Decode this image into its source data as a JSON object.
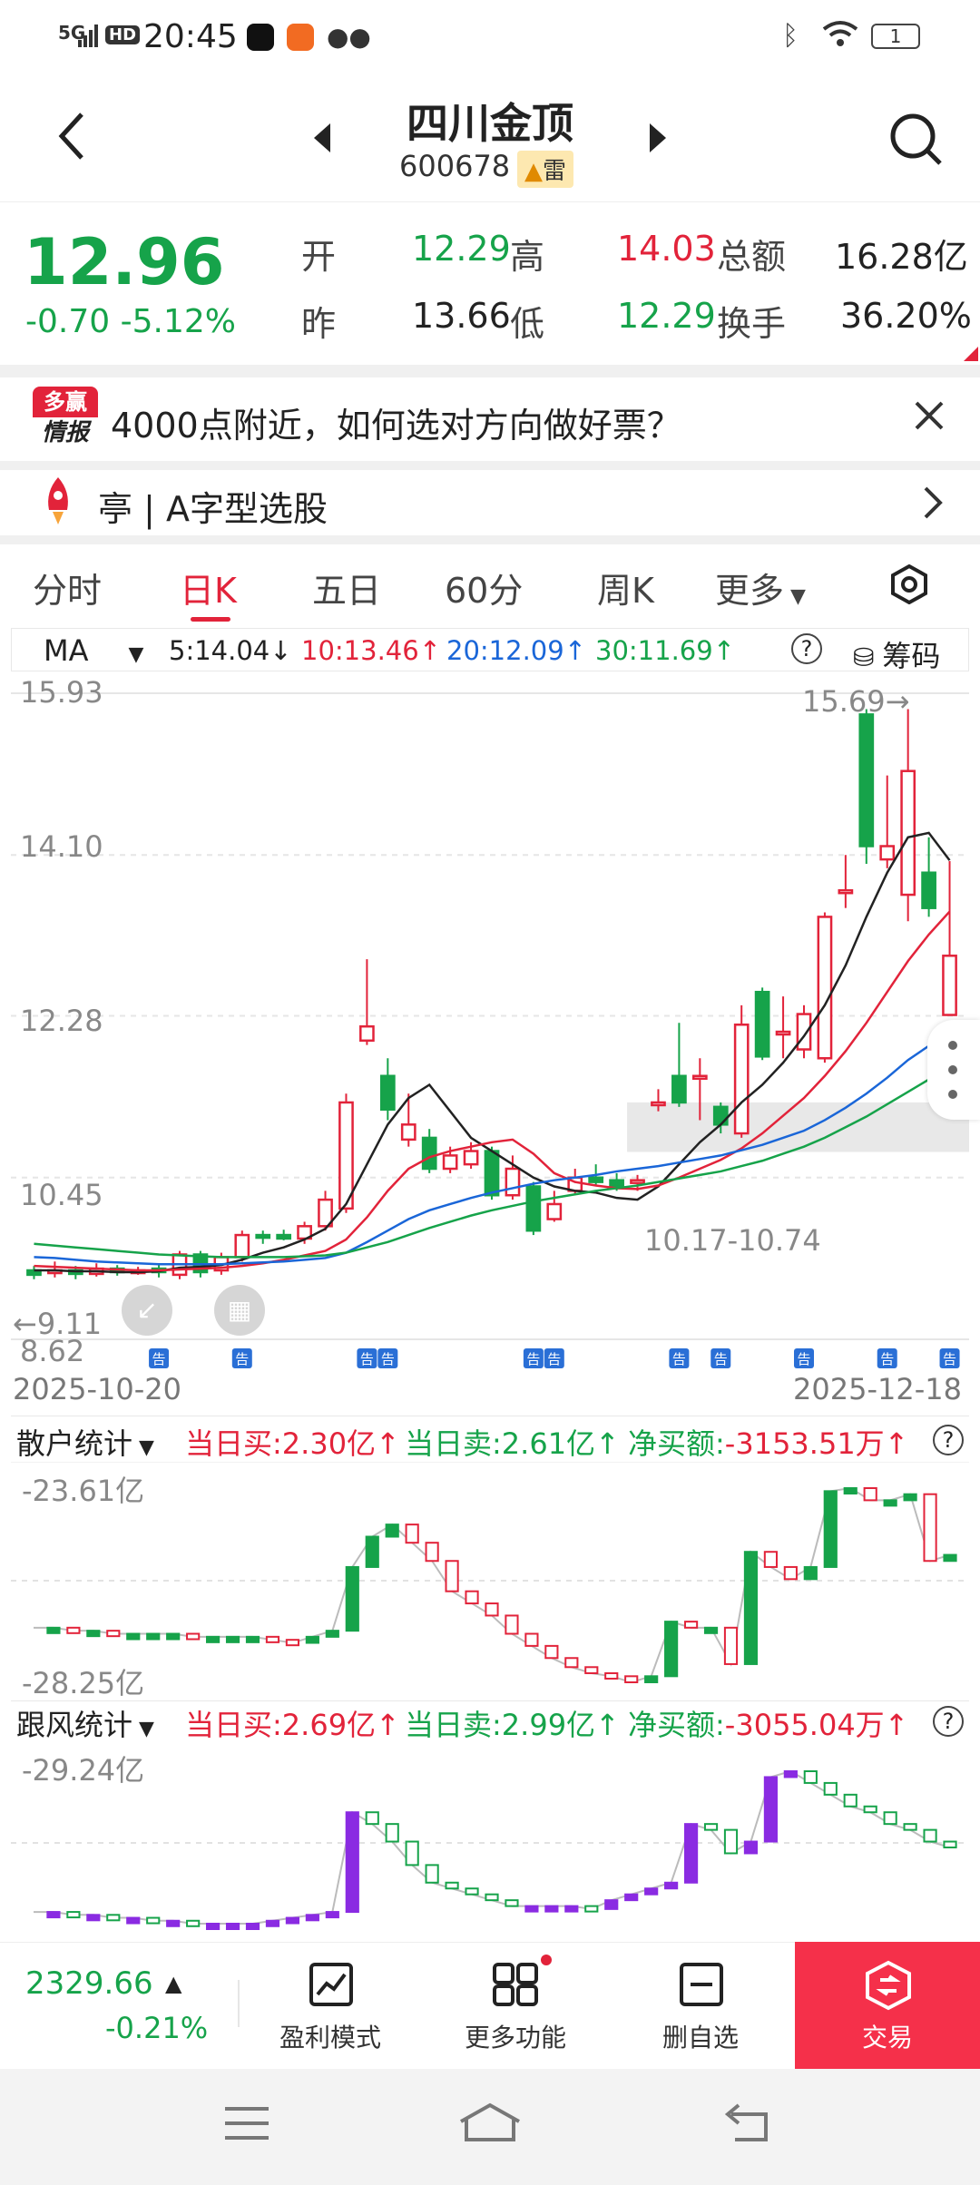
{
  "status": {
    "time": "20:45",
    "network": "5G",
    "battery": "1"
  },
  "header": {
    "title": "四川金顶",
    "code": "600678",
    "badge": "雷"
  },
  "quote": {
    "price": "12.96",
    "change": "-0.70",
    "change_pct": "-5.12%",
    "open_label": "开",
    "open": "12.29",
    "high_label": "高",
    "high": "14.03",
    "amount_label": "总额",
    "amount": "16.28亿",
    "prev_label": "昨",
    "prev": "13.66",
    "low_label": "低",
    "low": "12.29",
    "turnover_label": "换手",
    "turnover": "36.20%"
  },
  "banner": {
    "logo_top": "多赢",
    "logo_bottom": "情报",
    "text": "4000点附近，如何选对方向做好票？"
  },
  "ticker": {
    "text": "亭 | A字型选股"
  },
  "tabs": [
    "分时",
    "日K",
    "五日",
    "60分",
    "周K",
    "更多"
  ],
  "active_tab": "日K",
  "legend": {
    "indicator": "MA",
    "ma5": "5:14.04↓",
    "ma10": "10:13.46↑",
    "ma20": "20:12.09↑",
    "ma30": "30:11.69↑",
    "chips": "筹码"
  },
  "chart_data": {
    "type": "candlestick",
    "y_ticks": [
      "15.93",
      "14.10",
      "12.28",
      "10.45",
      "8.62"
    ],
    "ylim": [
      8.62,
      15.93
    ],
    "x_start": "2025-10-20",
    "x_end": "2025-12-18",
    "max_label": "15.69→",
    "min_label": "←9.11",
    "zone_label": "10.17-10.74",
    "candles": [
      {
        "o": 9.4,
        "c": 9.35,
        "h": 9.45,
        "l": 9.3
      },
      {
        "o": 9.38,
        "c": 9.4,
        "h": 9.5,
        "l": 9.32
      },
      {
        "o": 9.4,
        "c": 9.36,
        "h": 9.45,
        "l": 9.3
      },
      {
        "o": 9.36,
        "c": 9.42,
        "h": 9.48,
        "l": 9.33
      },
      {
        "o": 9.42,
        "c": 9.38,
        "h": 9.46,
        "l": 9.34
      },
      {
        "o": 9.38,
        "c": 9.4,
        "h": 9.44,
        "l": 9.35
      },
      {
        "o": 9.42,
        "c": 9.38,
        "h": 9.46,
        "l": 9.32
      },
      {
        "o": 9.35,
        "c": 9.58,
        "h": 9.62,
        "l": 9.3
      },
      {
        "o": 9.58,
        "c": 9.38,
        "h": 9.62,
        "l": 9.32
      },
      {
        "o": 9.4,
        "c": 9.55,
        "h": 9.6,
        "l": 9.35
      },
      {
        "o": 9.55,
        "c": 9.8,
        "h": 9.85,
        "l": 9.5
      },
      {
        "o": 9.8,
        "c": 9.78,
        "h": 9.85,
        "l": 9.7
      },
      {
        "o": 9.8,
        "c": 9.76,
        "h": 9.86,
        "l": 9.74
      },
      {
        "o": 9.76,
        "c": 9.9,
        "h": 9.95,
        "l": 9.7
      },
      {
        "o": 9.9,
        "c": 10.2,
        "h": 10.3,
        "l": 9.85
      },
      {
        "o": 10.1,
        "c": 11.3,
        "h": 11.4,
        "l": 10.05
      },
      {
        "o": 12.0,
        "c": 12.16,
        "h": 12.92,
        "l": 11.95
      },
      {
        "o": 11.6,
        "c": 11.22,
        "h": 11.8,
        "l": 11.1
      },
      {
        "o": 10.88,
        "c": 11.05,
        "h": 11.4,
        "l": 10.8
      },
      {
        "o": 10.9,
        "c": 10.55,
        "h": 11.0,
        "l": 10.5
      },
      {
        "o": 10.55,
        "c": 10.7,
        "h": 10.8,
        "l": 10.5
      },
      {
        "o": 10.6,
        "c": 10.75,
        "h": 10.85,
        "l": 10.55
      },
      {
        "o": 10.75,
        "c": 10.25,
        "h": 10.8,
        "l": 10.2
      },
      {
        "o": 10.25,
        "c": 10.55,
        "h": 10.7,
        "l": 10.2
      },
      {
        "o": 10.35,
        "c": 9.85,
        "h": 10.4,
        "l": 9.8
      },
      {
        "o": 9.98,
        "c": 10.15,
        "h": 10.3,
        "l": 9.95
      },
      {
        "o": 10.3,
        "c": 10.45,
        "h": 10.55,
        "l": 10.25
      },
      {
        "o": 10.45,
        "c": 10.4,
        "h": 10.6,
        "l": 10.35
      },
      {
        "o": 10.42,
        "c": 10.35,
        "h": 10.5,
        "l": 10.3
      },
      {
        "o": 10.4,
        "c": 10.42,
        "h": 10.48,
        "l": 10.3
      },
      {
        "o": 11.3,
        "c": 11.3,
        "h": 11.45,
        "l": 11.2
      },
      {
        "o": 11.6,
        "c": 11.3,
        "h": 12.2,
        "l": 11.25
      },
      {
        "o": 11.6,
        "c": 11.6,
        "h": 11.8,
        "l": 11.1
      },
      {
        "o": 11.25,
        "c": 11.05,
        "h": 11.3,
        "l": 10.95
      },
      {
        "o": 10.95,
        "c": 12.18,
        "h": 12.4,
        "l": 10.9
      },
      {
        "o": 12.55,
        "c": 11.82,
        "h": 12.6,
        "l": 11.78
      },
      {
        "o": 12.1,
        "c": 12.1,
        "h": 12.5,
        "l": 11.8
      },
      {
        "o": 11.9,
        "c": 12.3,
        "h": 12.4,
        "l": 11.8
      },
      {
        "o": 11.8,
        "c": 13.4,
        "h": 13.45,
        "l": 11.75
      },
      {
        "o": 13.7,
        "c": 13.7,
        "h": 14.1,
        "l": 13.5
      },
      {
        "o": 15.69,
        "c": 14.2,
        "h": 15.75,
        "l": 14.0
      },
      {
        "o": 14.05,
        "c": 14.2,
        "h": 15.0,
        "l": 13.95
      },
      {
        "o": 13.65,
        "c": 15.05,
        "h": 15.75,
        "l": 13.35
      },
      {
        "o": 13.9,
        "c": 13.5,
        "h": 14.3,
        "l": 13.4
      },
      {
        "o": 12.29,
        "c": 12.96,
        "h": 14.03,
        "l": 12.29
      }
    ],
    "ma5": [
      9.4,
      9.4,
      9.39,
      9.39,
      9.38,
      9.38,
      9.39,
      9.43,
      9.44,
      9.46,
      9.52,
      9.6,
      9.66,
      9.75,
      9.87,
      10.15,
      10.6,
      11.05,
      11.35,
      11.5,
      11.2,
      10.9,
      10.75,
      10.6,
      10.45,
      10.35,
      10.3,
      10.28,
      10.22,
      10.2,
      10.35,
      10.6,
      10.85,
      11.05,
      11.3,
      11.5,
      11.75,
      12.05,
      12.4,
      12.85,
      13.4,
      13.9,
      14.3,
      14.35,
      14.04
    ],
    "ma10": [
      9.45,
      9.44,
      9.43,
      9.42,
      9.41,
      9.4,
      9.4,
      9.41,
      9.42,
      9.43,
      9.45,
      9.48,
      9.52,
      9.57,
      9.62,
      9.75,
      10.0,
      10.3,
      10.55,
      10.68,
      10.75,
      10.8,
      10.85,
      10.88,
      10.72,
      10.5,
      10.4,
      10.36,
      10.33,
      10.32,
      10.36,
      10.45,
      10.55,
      10.65,
      10.78,
      10.95,
      11.15,
      11.35,
      11.6,
      11.88,
      12.2,
      12.55,
      12.9,
      13.2,
      13.46
    ],
    "ma20": [
      9.55,
      9.54,
      9.52,
      9.5,
      9.49,
      9.48,
      9.47,
      9.47,
      9.47,
      9.47,
      9.48,
      9.49,
      9.5,
      9.52,
      9.54,
      9.6,
      9.72,
      9.85,
      9.98,
      10.08,
      10.15,
      10.22,
      10.28,
      10.33,
      10.38,
      10.42,
      10.45,
      10.48,
      10.52,
      10.55,
      10.58,
      10.62,
      10.66,
      10.7,
      10.76,
      10.82,
      10.9,
      10.98,
      11.1,
      11.24,
      11.4,
      11.58,
      11.78,
      11.94,
      12.09
    ],
    "ma30": [
      9.7,
      9.68,
      9.66,
      9.64,
      9.62,
      9.6,
      9.58,
      9.57,
      9.56,
      9.55,
      9.55,
      9.55,
      9.55,
      9.56,
      9.57,
      9.6,
      9.66,
      9.72,
      9.8,
      9.88,
      9.95,
      10.02,
      10.08,
      10.13,
      10.18,
      10.22,
      10.26,
      10.3,
      10.33,
      10.36,
      10.4,
      10.44,
      10.48,
      10.52,
      10.58,
      10.64,
      10.72,
      10.8,
      10.9,
      11.02,
      11.14,
      11.28,
      11.42,
      11.56,
      11.69
    ],
    "announcements": [
      "告",
      "告",
      "告",
      "告",
      "告",
      "告",
      "告",
      "告",
      "告",
      "告",
      "告",
      "告"
    ]
  },
  "retail": {
    "title": "散户统计",
    "buy_label": "当日买:",
    "buy": "2.30亿↑",
    "sell_label": "当日卖:",
    "sell": "2.61亿↑",
    "net_label": "净买额:",
    "net": "-3153.51万↑",
    "top": "-23.61亿",
    "bottom": "-28.25亿"
  },
  "follow": {
    "title": "跟风统计",
    "buy_label": "当日买:",
    "buy": "2.69亿↑",
    "sell_label": "当日卖:",
    "sell": "2.99亿↑",
    "net_label": "净买额:",
    "net": "-3055.04万↑",
    "top": "-29.24亿"
  },
  "bottom_nav": {
    "index_value": "2329.66",
    "index_change": "-0.21%",
    "items": [
      "盈利模式",
      "更多功能",
      "删自选",
      "交易"
    ]
  },
  "colors": {
    "up": "#e2233a",
    "down": "#16a34a",
    "ma5": "#222222",
    "ma10": "#e2233a",
    "ma20": "#1a66d8",
    "ma30": "#16a34a",
    "accent": "#f5304a"
  }
}
